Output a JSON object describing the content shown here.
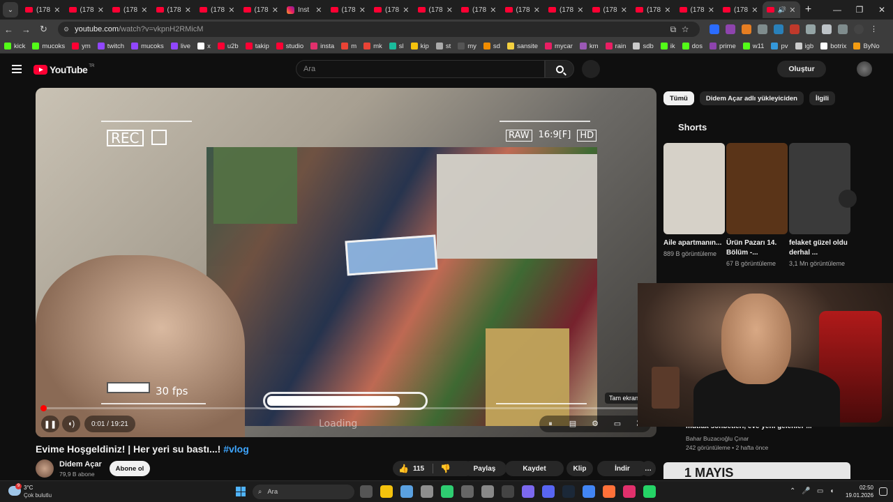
{
  "browser": {
    "tabs": [
      {
        "title": "(178"
      },
      {
        "title": "(178"
      },
      {
        "title": "(178"
      },
      {
        "title": "(178"
      },
      {
        "title": "(178"
      },
      {
        "title": "(178"
      },
      {
        "title": "Inst"
      },
      {
        "title": "(178"
      },
      {
        "title": "(178"
      },
      {
        "title": "(178"
      },
      {
        "title": "(178"
      },
      {
        "title": "(178"
      },
      {
        "title": "(178"
      },
      {
        "title": "(178"
      },
      {
        "title": "(178"
      },
      {
        "title": "(178"
      },
      {
        "title": "(178"
      }
    ],
    "url_host": "youtube.com",
    "url_path": "/watch?v=vkpnH2RMicM",
    "bookmarks": [
      {
        "label": "kick",
        "color": "#53fc18"
      },
      {
        "label": "mucoks",
        "color": "#53fc18"
      },
      {
        "label": "ym",
        "color": "#ff0033"
      },
      {
        "label": "twitch",
        "color": "#9146ff"
      },
      {
        "label": "mucoks",
        "color": "#9146ff"
      },
      {
        "label": "live",
        "color": "#9146ff"
      },
      {
        "label": "x",
        "color": "#ffffff"
      },
      {
        "label": "u2b",
        "color": "#ff0033"
      },
      {
        "label": "takip",
        "color": "#ff0033"
      },
      {
        "label": "studio",
        "color": "#ff0033"
      },
      {
        "label": "insta",
        "color": "#e1306c"
      },
      {
        "label": "m",
        "color": "#ea4335"
      },
      {
        "label": "mk",
        "color": "#ea4335"
      },
      {
        "label": "sl",
        "color": "#1abc9c"
      },
      {
        "label": "kip",
        "color": "#f4c20d"
      },
      {
        "label": "st",
        "color": "#aaaaaa"
      },
      {
        "label": "my",
        "color": "#555555"
      },
      {
        "label": "sd",
        "color": "#f08c00"
      },
      {
        "label": "sansite",
        "color": "#f4d03f"
      },
      {
        "label": "mycar",
        "color": "#e91e63"
      },
      {
        "label": "km",
        "color": "#9b59b6"
      },
      {
        "label": "rain",
        "color": "#e91e63"
      },
      {
        "label": "sdb",
        "color": "#cccccc"
      },
      {
        "label": "ik",
        "color": "#53fc18"
      },
      {
        "label": "dos",
        "color": "#53fc18"
      },
      {
        "label": "prime",
        "color": "#8e44ad"
      },
      {
        "label": "w11",
        "color": "#53fc18"
      },
      {
        "label": "pv",
        "color": "#3498db"
      },
      {
        "label": "igb",
        "color": "#cccccc"
      },
      {
        "label": "botrix",
        "color": "#ffffff"
      },
      {
        "label": "ByNo",
        "color": "#f39c12"
      }
    ]
  },
  "youtube": {
    "logo_text": "YouTube",
    "logo_region": "TR",
    "search_placeholder": "Ara",
    "create_label": "Oluştur",
    "player": {
      "hud_rec": "REC",
      "hud_raw": "RAW",
      "hud_ratio": "16:9[F]",
      "hud_hd": "HD",
      "hud_fps": "30 fps",
      "hud_loading": "Loading",
      "tooltip": "Tam ekran",
      "time": "0:01 / 19:21",
      "progress_fraction": 0.0009
    },
    "video_title": "Evime Hoşgeldiniz! | Her yeri su bastı...!",
    "video_tag": "#vlog",
    "channel_name": "Didem Açar",
    "channel_subs": "79,9 B abone",
    "subscribe_label": "Abone ol",
    "like_count": "115",
    "share_label": "Paylaş",
    "save_label": "Kaydet",
    "clip_label": "Klip",
    "download_label": "İndir",
    "chips": [
      "Tümü",
      "Didem Açar adlı yükleyiciden",
      "İlgili"
    ],
    "shorts_title": "Shorts",
    "shorts": [
      {
        "title": "Aile apartmanın...",
        "views": "889 B görüntüleme",
        "color": "#d6d1c8"
      },
      {
        "title": "Ürün Pazarı 14. Bölüm -...",
        "views": "67 B görüntüleme",
        "color": "#5a3418"
      },
      {
        "title": "felaket güzel oldu derhal ...",
        "views": "3,1 Mn görüntüleme",
        "color": "#3a3a3a"
      }
    ],
    "recommended": {
      "title": "mutfak sohbetleri, eve yeni gelenler ...",
      "channel": "Bahar Buzacıoğlu Çınar",
      "meta": "242 görüntüleme • 2 hafta önce",
      "thumb_text": "1 MAYIS"
    }
  },
  "taskbar": {
    "temperature": "3°C",
    "condition": "Çok bulutlu",
    "weather_badge": "9",
    "search_placeholder": "Ara",
    "time": "02:50",
    "date": "19.01.2026"
  }
}
